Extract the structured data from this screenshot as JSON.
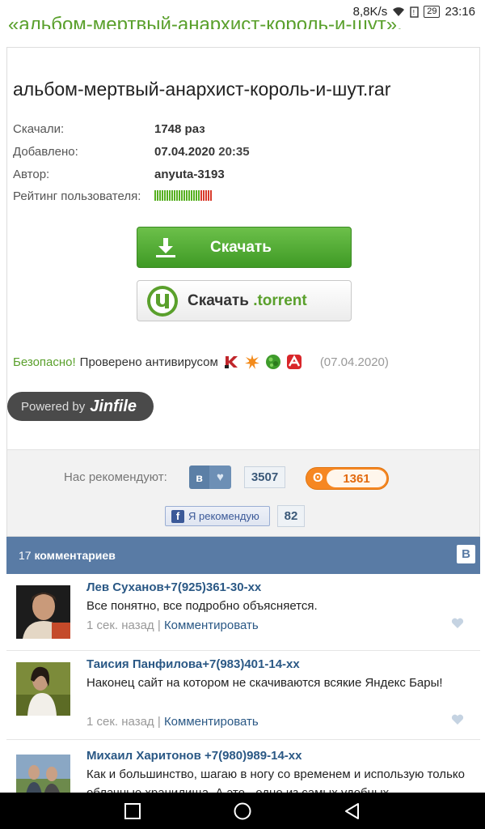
{
  "status_bar": {
    "speed": "8,8K/s",
    "battery": "29",
    "time": "23:16"
  },
  "previous_title": "«альбом-мертвый-анархист-король-и-шут».",
  "file": {
    "name": "альбом-мертвый-анархист-король-и-шут.rar",
    "downloads_label": "Скачали:",
    "downloads_value": "1748 раз",
    "added_label": "Добавлено:",
    "added_date": "07.04.2020",
    "added_time": "20:35",
    "author_label": "Автор:",
    "author_value": "anyuta-3193",
    "rating_label": "Рейтинг пользователя:",
    "rating_fraction": 0.78,
    "rating_colors": {
      "good": "#57b021",
      "bad": "#d83a2a"
    }
  },
  "buttons": {
    "download_label": "Скачать",
    "torrent_label_main": "Скачать",
    "torrent_label_ext": ".torrent"
  },
  "antivirus": {
    "safe_label": "Безопасно!",
    "checked_label": "Проверено антивирусом",
    "date": "(07.04.2020)",
    "icons": [
      "kaspersky-icon",
      "avast-icon",
      "drweb-icon",
      "avira-icon"
    ]
  },
  "powered": {
    "prefix": "Powered by",
    "brand": "Jinfile"
  },
  "recommend": {
    "label": "Нас рекомендуют:",
    "vk_letter": "в",
    "vk_count": "3507",
    "ok_count": "1361",
    "fb_label": "Я рекомендую",
    "fb_count": "82"
  },
  "comments_header": {
    "count": "17",
    "label": "комментариев",
    "vk_letter": "B"
  },
  "comments": [
    {
      "name": "Лев  Суханов+7(925)361-30-xx",
      "text": "Все понятно, все подробно объясняется.",
      "time": "1 сек. назад",
      "sep": "|",
      "reply": "Комментировать"
    },
    {
      "name": "Таисия  Панфилова+7(983)401-14-xx",
      "text": "Наконец сайт на котором не скачиваются всякие Яндекс Бары!",
      "time": "1 сек. назад",
      "sep": "|",
      "reply": "Комментировать"
    },
    {
      "name": "Михаил  Харитонов +7(980)989-14-xx",
      "text": "Как и большинство, шагаю в ногу со временем и использую только облачные хранилища. А это - одно из самых удобных.",
      "time": "",
      "sep": "",
      "reply": ""
    }
  ],
  "colors": {
    "green": "#5aa02c",
    "vk_blue": "#597ba5",
    "ok_orange": "#f68722",
    "link": "#2a5885"
  }
}
